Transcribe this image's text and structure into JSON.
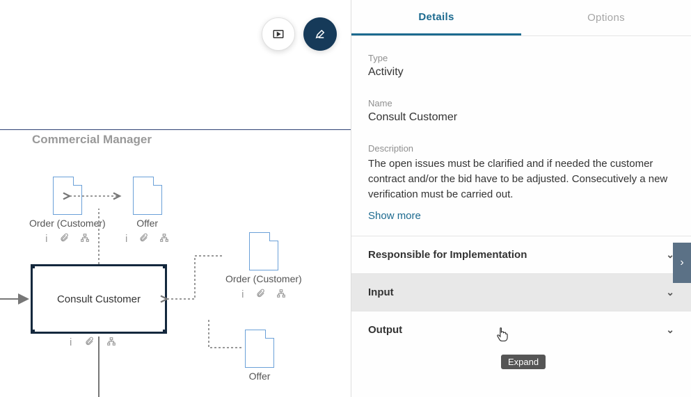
{
  "canvas": {
    "lane_title": "Commercial Manager",
    "activity_label": "Consult Customer",
    "docs": {
      "top_left": "Order (Customer)",
      "top_right": "Offer",
      "mid_right": "Order (Customer)",
      "bottom_right": "Offer"
    }
  },
  "tabs": {
    "details": "Details",
    "options": "Options"
  },
  "details": {
    "type_label": "Type",
    "type_value": "Activity",
    "name_label": "Name",
    "name_value": "Consult Customer",
    "description_label": "Description",
    "description_value": "The open issues must be clarified and if needed the customer contract and/or the bid have to be adjusted. Consecutively a new verification must be carried out.",
    "show_more": "Show more"
  },
  "sections": {
    "responsible": "Responsible for Implementation",
    "input": "Input",
    "output": "Output"
  },
  "tooltip": "Expand"
}
